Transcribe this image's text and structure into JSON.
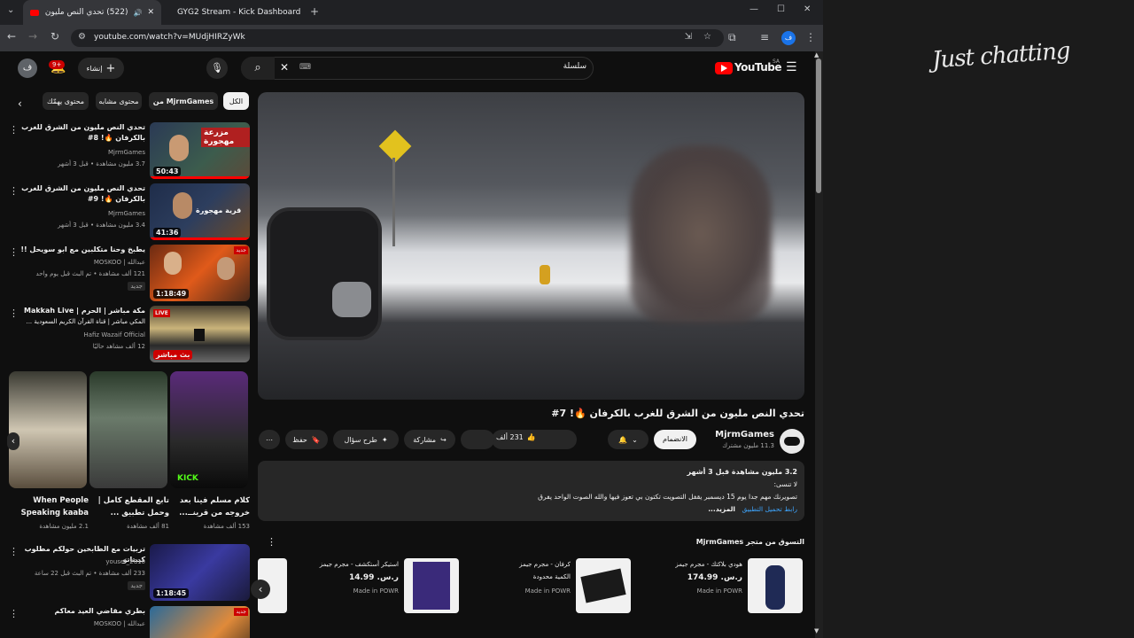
{
  "browser": {
    "tabs": [
      {
        "title": "(522) تحدي النص مليون من",
        "active": true
      },
      {
        "title": "GYG2 Stream - Kick Dashboard",
        "active": false
      }
    ],
    "url": "youtube.com/watch?v=MUdjHIRZyWk"
  },
  "youtube": {
    "logo": "YouTube",
    "region": "SA",
    "search_value": "سلسلة",
    "create_label": "إنشاء",
    "notifications": "9+",
    "avatar_letter": "ف"
  },
  "chips": [
    "الكل",
    "من MjrmGames",
    "محتوى مشابه",
    "محتوى يهمّك"
  ],
  "related": [
    {
      "title": "تحدي النص مليون من الشرق للغرب بالكرفان 🔥! 8#",
      "channel": "MjrmGames",
      "meta": "3.7 مليون مشاهدة • قبل 3 أشهر",
      "duration": "50:43",
      "thumb_text": "مزرعة مهجورة"
    },
    {
      "title": "تحدي النص مليون من الشرق للغرب بالكرفان 🔥! 9#",
      "channel": "MjrmGames",
      "meta": "3.4 مليون مشاهدة • قبل 3 أشهر",
      "duration": "41:36",
      "thumb_text": "قرية مهجورة"
    },
    {
      "title": "يطبخ وحنا متكلبين مع ابو سويحل !!",
      "channel": "عبدالله | MOSKOO",
      "meta": "121 ألف مشاهدة • تم البث قبل يوم واحد",
      "badge": "جديد",
      "duration": "1:18:49",
      "thumb_text": "جديد"
    },
    {
      "title": "مكة مباشر | الحرم | Makkah Live",
      "title2": "المكي مباشر | قناة القرآن الكريم السعودية ...",
      "channel": "Hafiz Wazaif Official",
      "meta": "12 ألف مشاهد حاليًا",
      "duration": "بث مباشر",
      "thumb_text": "LIVE"
    }
  ],
  "shorts": [
    {
      "title": "كلام مسلم فينا بعد خروجه من قرينــ...",
      "views": "153 ألف مشاهدة"
    },
    {
      "title": "تابع المقطع كامل | وحمل تطبيق ...",
      "views": "81 ألف مشاهدة"
    },
    {
      "title": "When People Speaking kaaba",
      "views": "2.1 مليون مشاهدة"
    }
  ],
  "related2": [
    {
      "title": "تربيات مع الطابخين حولكم مطلوب كيبتاتو",
      "channel": "yousef_2010",
      "meta": "233 ألف مشاهدة • تم البث قبل 22 ساعة",
      "badge": "جديد",
      "duration": "1:18:45"
    },
    {
      "title": "بطري مقاضي العيد معاكم",
      "channel": "عبدالله | MOSKOO",
      "meta": "",
      "duration": "",
      "thumb_text": "جديد"
    }
  ],
  "video": {
    "title": "تحدي النص مليون من الشرق للغرب بالكرفان 🔥! 7#",
    "channel": "MjrmGames",
    "subscribers": "11.3 مليون مشترك",
    "join_label": "الانضمام",
    "likes": "231 ألف",
    "share_label": "مشاركة",
    "ask_label": "طرح سؤال",
    "save_label": "حفظ",
    "desc_views": "3.2 مليون مشاهدة  قبل 3 أشهر",
    "desc_line1": "لا تنسى:",
    "desc_line2": "تصويرنك مهم جدا يوم 15 ديسمبر يقفل التصويت تكتون بي تعوز فيها والله الصوت الواحد يفرق",
    "desc_line3": "رابط تحميل التطبيق",
    "more_label": "...المزيد"
  },
  "store": {
    "heading": "التسوق من متجر MjrmGames",
    "products": [
      {
        "title": "هودي بلاكتك - مجرم جيمز",
        "price": "ر.س. 174.99",
        "seller": "Made in POWR"
      },
      {
        "title": "كرفان - مجرم جيمز",
        "price": "الكمية محدودة",
        "seller": "Made in POWR"
      },
      {
        "title": "استيكر أستكشف - مجرم جيمز",
        "price": "ر.س. 14.99",
        "seller": "Made in POWR"
      }
    ]
  },
  "overlay_text": "Just chatting"
}
